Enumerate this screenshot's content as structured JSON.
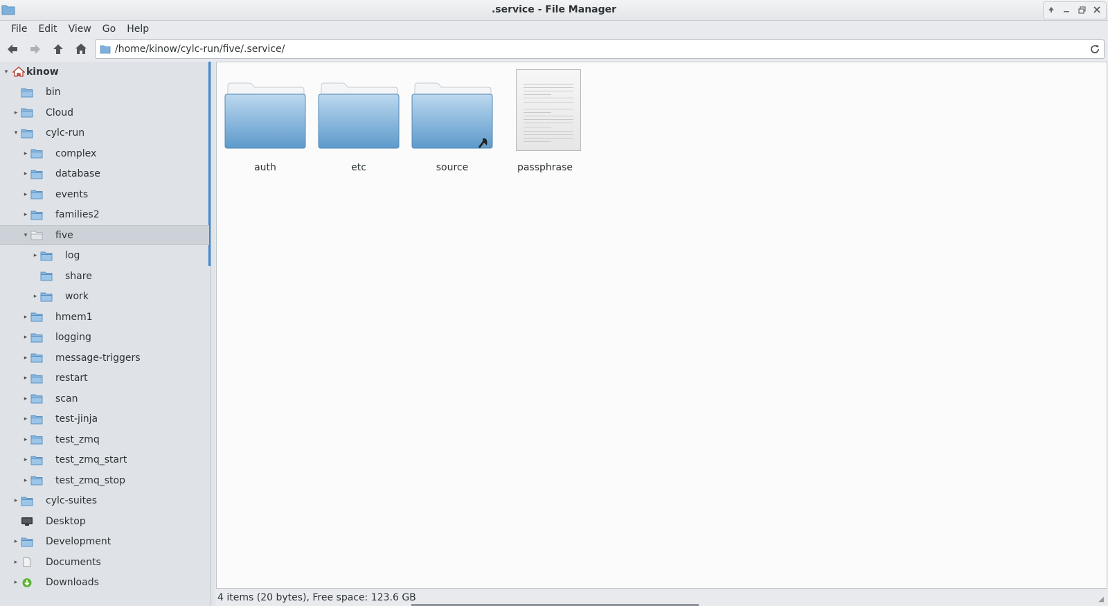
{
  "window": {
    "title": ".service - File Manager"
  },
  "menubar": {
    "items": [
      "File",
      "Edit",
      "View",
      "Go",
      "Help"
    ]
  },
  "toolbar": {
    "back_icon": "arrow-left-icon",
    "forward_icon": "arrow-right-icon",
    "up_icon": "arrow-up-icon",
    "home_icon": "home-icon",
    "address": "/home/kinow/cylc-run/five/.service/",
    "reload_icon": "reload-icon"
  },
  "sidebar": {
    "items": [
      {
        "label": "kinow",
        "icon": "home-icon",
        "expander": "expanded"
      },
      {
        "label": "bin",
        "icon": "folder-icon",
        "expander": "none"
      },
      {
        "label": "Cloud",
        "icon": "folder-icon",
        "expander": "collapsed"
      },
      {
        "label": "cylc-run",
        "icon": "folder-icon",
        "expander": "expanded"
      },
      {
        "label": "complex",
        "icon": "folder-icon",
        "expander": "collapsed"
      },
      {
        "label": "database",
        "icon": "folder-icon",
        "expander": "collapsed"
      },
      {
        "label": "events",
        "icon": "folder-icon",
        "expander": "collapsed"
      },
      {
        "label": "families2",
        "icon": "folder-icon",
        "expander": "collapsed"
      },
      {
        "label": "five",
        "icon": "folder-open-icon",
        "expander": "expanded",
        "selected": true
      },
      {
        "label": "log",
        "icon": "folder-icon",
        "expander": "collapsed"
      },
      {
        "label": "share",
        "icon": "folder-icon",
        "expander": "none"
      },
      {
        "label": "work",
        "icon": "folder-icon",
        "expander": "collapsed"
      },
      {
        "label": "hmem1",
        "icon": "folder-icon",
        "expander": "collapsed"
      },
      {
        "label": "logging",
        "icon": "folder-icon",
        "expander": "collapsed"
      },
      {
        "label": "message-triggers",
        "icon": "folder-icon",
        "expander": "collapsed"
      },
      {
        "label": "restart",
        "icon": "folder-icon",
        "expander": "collapsed"
      },
      {
        "label": "scan",
        "icon": "folder-icon",
        "expander": "collapsed"
      },
      {
        "label": "test-jinja",
        "icon": "folder-icon",
        "expander": "collapsed"
      },
      {
        "label": "test_zmq",
        "icon": "folder-icon",
        "expander": "collapsed"
      },
      {
        "label": "test_zmq_start",
        "icon": "folder-icon",
        "expander": "collapsed"
      },
      {
        "label": "test_zmq_stop",
        "icon": "folder-icon",
        "expander": "collapsed"
      },
      {
        "label": "cylc-suites",
        "icon": "folder-icon",
        "expander": "collapsed"
      },
      {
        "label": "Desktop",
        "icon": "desktop-icon",
        "expander": "none"
      },
      {
        "label": "Development",
        "icon": "folder-icon",
        "expander": "collapsed"
      },
      {
        "label": "Documents",
        "icon": "document-folder-icon",
        "expander": "collapsed"
      },
      {
        "label": "Downloads",
        "icon": "download-icon",
        "expander": "collapsed"
      }
    ]
  },
  "main": {
    "items": [
      {
        "label": "auth",
        "type": "folder"
      },
      {
        "label": "etc",
        "type": "folder"
      },
      {
        "label": "source",
        "type": "folder-symlink"
      },
      {
        "label": "passphrase",
        "type": "text-file"
      }
    ]
  },
  "statusbar": {
    "text": "4 items (20 bytes), Free space: 123.6 GB"
  },
  "colors": {
    "folder_blue": "#6fa7d6",
    "accent": "#3d86d6"
  }
}
